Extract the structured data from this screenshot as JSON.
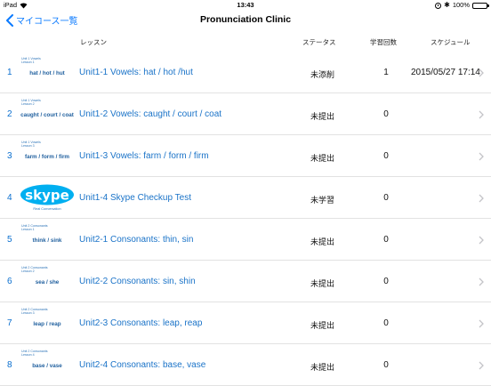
{
  "status_bar": {
    "device": "iPad",
    "time": "13:43",
    "battery": "100%"
  },
  "nav": {
    "back_label": "マイコース一覧",
    "title": "Pronunciation Clinic"
  },
  "columns": {
    "lesson": "レッスン",
    "status": "ステータス",
    "count": "学習回数",
    "schedule": "スケジュール"
  },
  "colors": {
    "link_blue": "#1a73c8",
    "ios_blue": "#0a7aff",
    "skype_blue": "#00aff0"
  },
  "lessons": [
    {
      "num": "1",
      "thumb_unit": "Unit 1 Vowels",
      "thumb_lesson": "Lesson 1",
      "thumb_words": "hat / hot / hut",
      "title": "Unit1-1 Vowels: hat / hot /hut",
      "status": "未添削",
      "count": "1",
      "date": "2015/05/27 17:14"
    },
    {
      "num": "2",
      "thumb_unit": "Unit 1 Vowels",
      "thumb_lesson": "Lesson 2",
      "thumb_words": "caught / court / coat",
      "title": "Unit1-2 Vowels: caught / court / coat",
      "status": "未提出",
      "count": "0",
      "date": ""
    },
    {
      "num": "3",
      "thumb_unit": "Unit 1 Vowels",
      "thumb_lesson": "Lesson 3",
      "thumb_words": "farm / form / firm",
      "title": "Unit1-3 Vowels: farm / form / firm",
      "status": "未提出",
      "count": "0",
      "date": ""
    },
    {
      "num": "4",
      "thumb_logo": "skype",
      "thumb_logo_text": "skype",
      "thumb_sub": "Real Conversation",
      "title": "Unit1-4 Skype Checkup Test",
      "status": "未学習",
      "count": "0",
      "date": ""
    },
    {
      "num": "5",
      "thumb_unit": "Unit 2 Consonants",
      "thumb_lesson": "Lesson 1",
      "thumb_words": "think / sink",
      "title": "Unit2-1 Consonants: thin, sin",
      "status": "未提出",
      "count": "0",
      "date": ""
    },
    {
      "num": "6",
      "thumb_unit": "Unit 2 Consonants",
      "thumb_lesson": "Lesson 2",
      "thumb_words": "sea / she",
      "title": "Unit2-2 Consonants: sin, shin",
      "status": "未提出",
      "count": "0",
      "date": ""
    },
    {
      "num": "7",
      "thumb_unit": "Unit 2 Consonants",
      "thumb_lesson": "Lesson 3",
      "thumb_words": "leap / reap",
      "title": "Unit2-3 Consonants: leap, reap",
      "status": "未提出",
      "count": "0",
      "date": ""
    },
    {
      "num": "8",
      "thumb_unit": "Unit 2 Consonants",
      "thumb_lesson": "Lesson 4",
      "thumb_words": "base / vase",
      "title": "Unit2-4 Consonants: base, vase",
      "status": "未提出",
      "count": "0",
      "date": ""
    }
  ]
}
